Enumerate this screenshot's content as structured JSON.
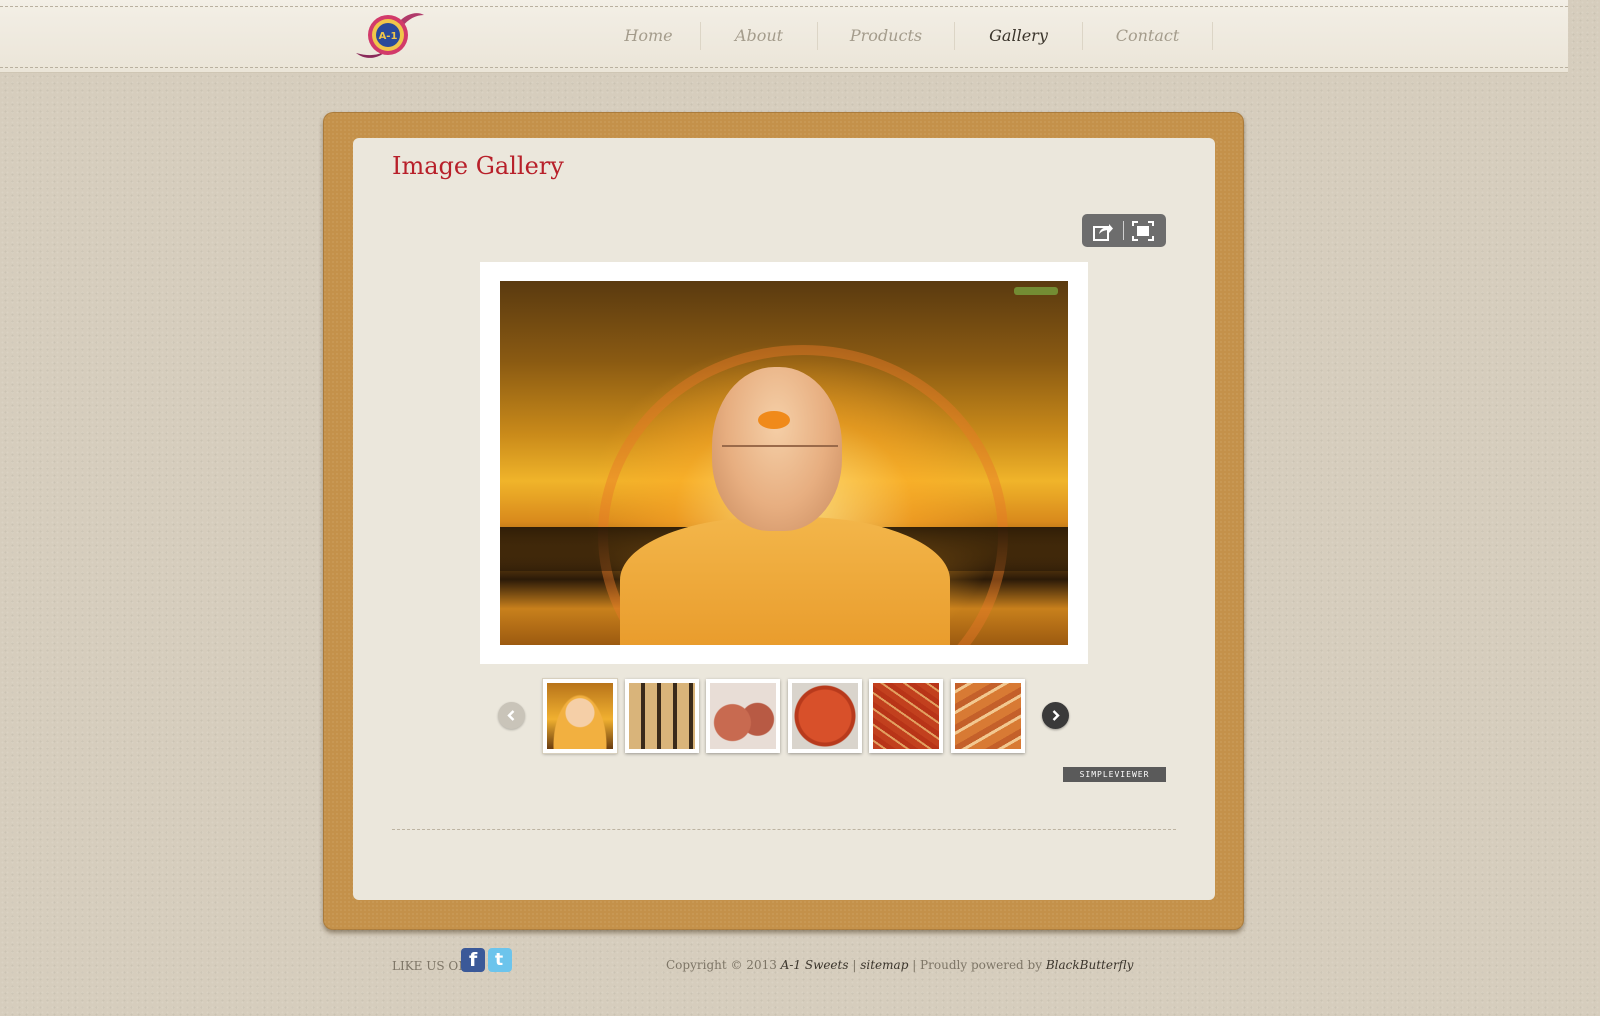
{
  "header": {
    "logo_icon": "a1-sweets-logo",
    "logo_text": "A-1",
    "nav": [
      {
        "label": "Home",
        "active": false
      },
      {
        "label": "About",
        "active": false
      },
      {
        "label": "Products",
        "active": false
      },
      {
        "label": "Gallery",
        "active": true
      },
      {
        "label": "Contact",
        "active": false
      }
    ]
  },
  "gallery": {
    "title": "Image Gallery",
    "toolbar": {
      "share_icon": "share-icon",
      "fullscreen_icon": "fullscreen-icon"
    },
    "main_image_icon": "portrait-photo",
    "thumbnails": [
      {
        "icon": "portrait-thumbnail",
        "active": true
      },
      {
        "icon": "rolls-sweet-thumbnail",
        "active": false
      },
      {
        "icon": "gulab-jamun-thumbnail",
        "active": false
      },
      {
        "icon": "halwa-thumbnail",
        "active": false
      },
      {
        "icon": "almond-halwa-thumbnail",
        "active": false
      },
      {
        "icon": "barfi-thumbnail",
        "active": false
      }
    ],
    "prev_icon": "chevron-left-icon",
    "next_icon": "chevron-right-icon",
    "badge": "SIMPLEVIEWER"
  },
  "footer": {
    "like_text": "LIKE US ON",
    "facebook_icon": "facebook-icon",
    "twitter_icon": "twitter-icon",
    "copyright_prefix": "Copyright © 2013",
    "brand": "A-1 Sweets",
    "separator": "|",
    "sitemap": "sitemap",
    "powered_prefix": "| Proudly powered by",
    "powered_by": "BlackButterfly"
  },
  "colors": {
    "background": "#d6cdbd",
    "frame": "#c4914a",
    "panel": "#ebe7dc",
    "title": "#b8202a",
    "nav_active": "#3a342b",
    "nav_inactive": "#a49c8c"
  }
}
